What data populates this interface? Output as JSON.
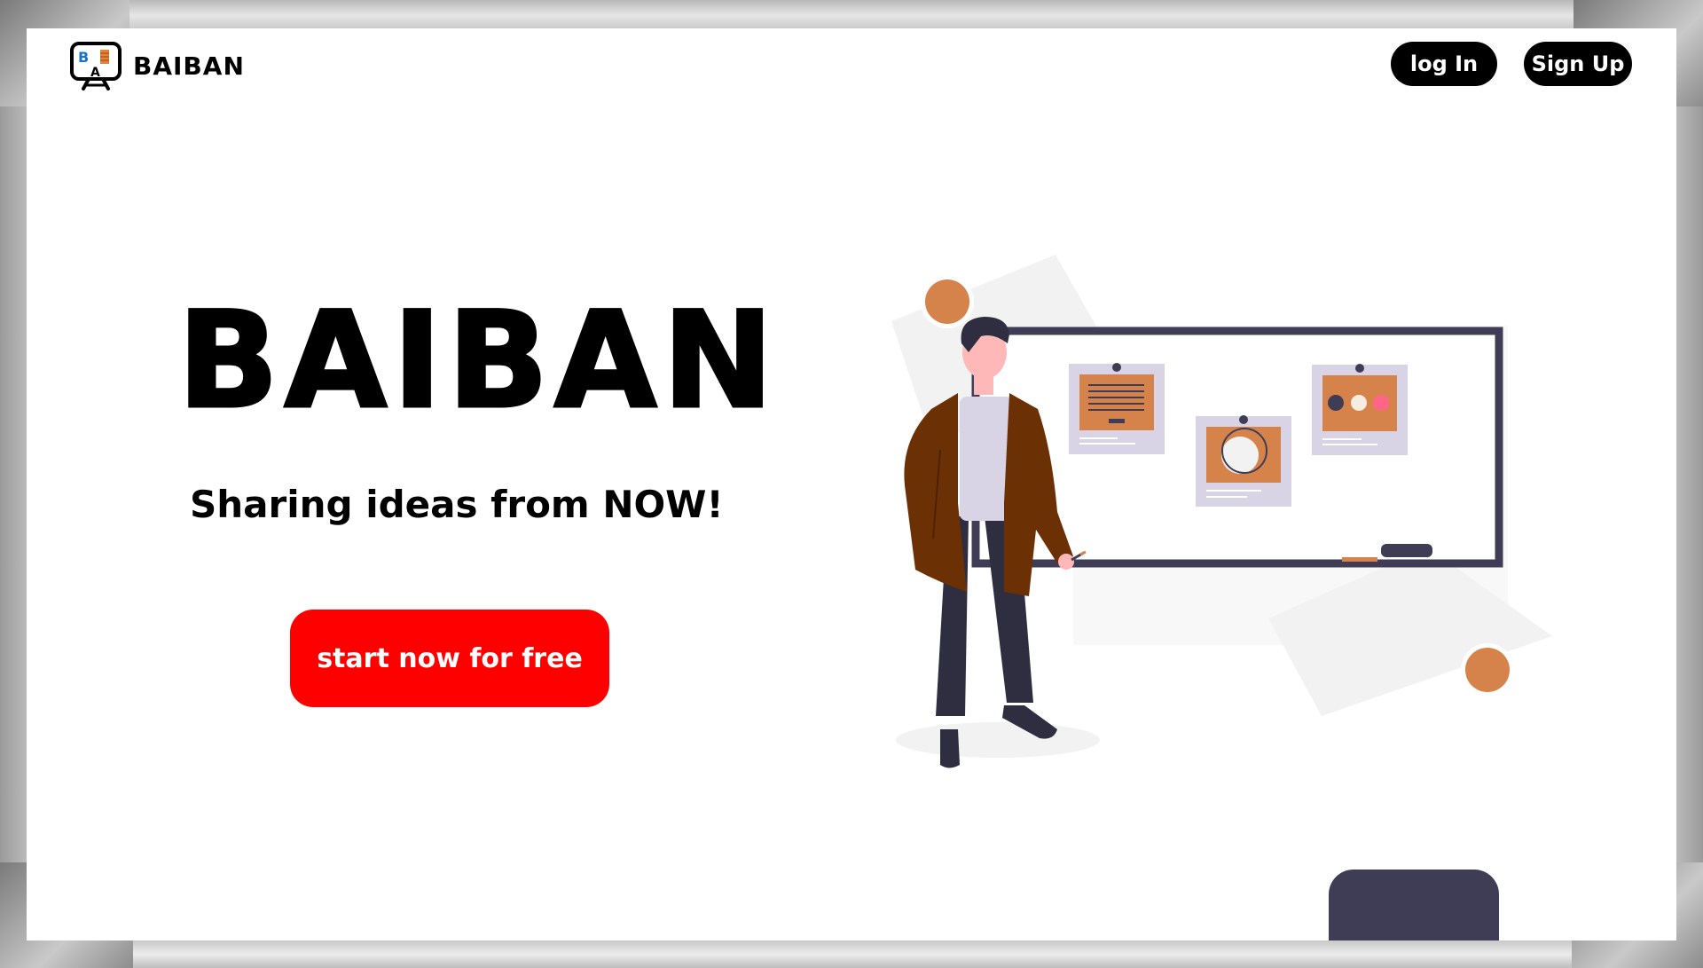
{
  "brand": {
    "name": "BAIBAN",
    "logo_icon": "whiteboard-logo-icon",
    "logo_letters": [
      "B",
      "A"
    ]
  },
  "nav": {
    "login_label": "log In",
    "signup_label": "Sign Up"
  },
  "hero": {
    "title": "BAIBAN",
    "subtitle": "Sharing ideas from NOW!",
    "cta_label": "start now for free"
  },
  "illustration": {
    "icon": "person-presenting-whiteboard-illustration"
  },
  "colors": {
    "accent": "#ff0000",
    "button_dark": "#000000",
    "illustration_dark": "#3f3d56",
    "illustration_orange": "#d6834b",
    "coat_brown": "#6b3004"
  }
}
